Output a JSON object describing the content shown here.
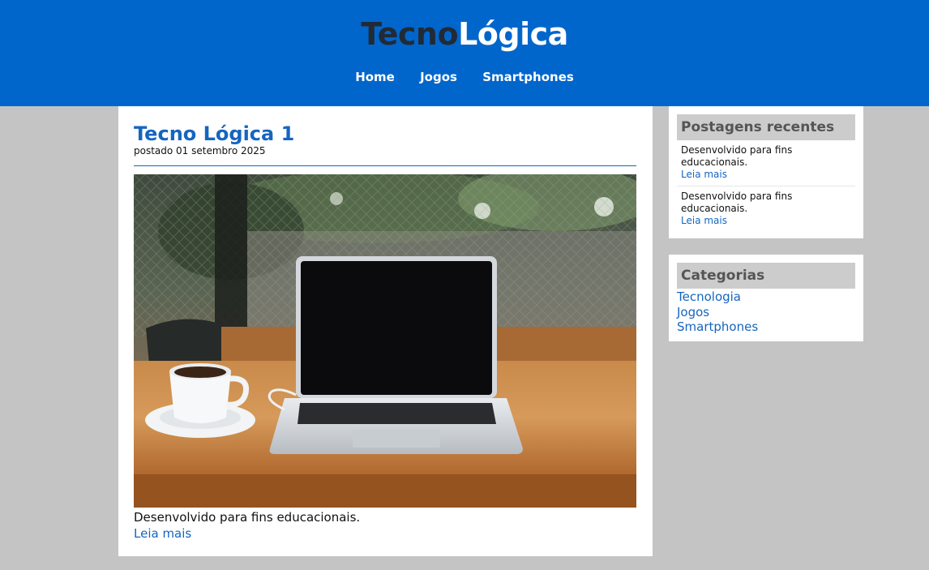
{
  "site": {
    "logo_part1": "Tecno",
    "logo_part2": "Lógica"
  },
  "nav": {
    "items": [
      {
        "label": "Home"
      },
      {
        "label": "Jogos"
      },
      {
        "label": "Smartphones"
      }
    ]
  },
  "post": {
    "title": "Tecno Lógica 1",
    "date": "postado 01 setembro 2025",
    "excerpt": "Desenvolvido para fins educacionais.",
    "read_more": "Leia mais"
  },
  "sidebar": {
    "recent": {
      "title": "Postagens recentes",
      "items": [
        {
          "text": "Desenvolvido para fins educacionais.",
          "link": "Leia mais"
        },
        {
          "text": "Desenvolvido para fins educacionais.",
          "link": "Leia mais"
        }
      ]
    },
    "categories": {
      "title": "Categorias",
      "items": [
        {
          "label": "Tecnologia"
        },
        {
          "label": "Jogos"
        },
        {
          "label": "Smartphones"
        }
      ]
    }
  },
  "colors": {
    "header_bg": "#0066cc",
    "link": "#1565c0",
    "page_bg": "#c4c4c4",
    "widget_title_bg": "#cccccc"
  }
}
